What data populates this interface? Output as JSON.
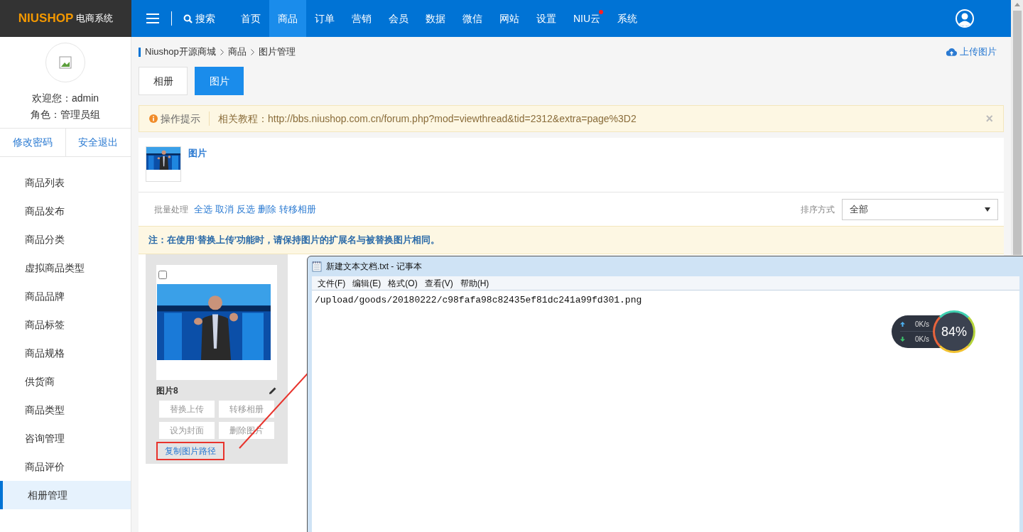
{
  "topbar": {
    "logo_brand": "NIUSHOP",
    "logo_sub": "电商系统",
    "search": "搜索",
    "nav": [
      {
        "label": "首页",
        "selected": false,
        "badge": false
      },
      {
        "label": "商品",
        "selected": true,
        "badge": false
      },
      {
        "label": "订单",
        "selected": false,
        "badge": false
      },
      {
        "label": "营销",
        "selected": false,
        "badge": false
      },
      {
        "label": "会员",
        "selected": false,
        "badge": false
      },
      {
        "label": "数据",
        "selected": false,
        "badge": false
      },
      {
        "label": "微信",
        "selected": false,
        "badge": false
      },
      {
        "label": "网站",
        "selected": false,
        "badge": false
      },
      {
        "label": "设置",
        "selected": false,
        "badge": false
      },
      {
        "label": "NIU云",
        "selected": false,
        "badge": true
      },
      {
        "label": "系统",
        "selected": false,
        "badge": false
      }
    ]
  },
  "sidebar": {
    "welcome": "欢迎您：admin",
    "role": "角色：管理员组",
    "actions": [
      "修改密码",
      "安全退出"
    ],
    "items": [
      {
        "label": "商品列表",
        "selected": false
      },
      {
        "label": "商品发布",
        "selected": false
      },
      {
        "label": "商品分类",
        "selected": false
      },
      {
        "label": "虚拟商品类型",
        "selected": false
      },
      {
        "label": "商品品牌",
        "selected": false
      },
      {
        "label": "商品标签",
        "selected": false
      },
      {
        "label": "商品规格",
        "selected": false
      },
      {
        "label": "供货商",
        "selected": false
      },
      {
        "label": "商品类型",
        "selected": false
      },
      {
        "label": "咨询管理",
        "selected": false
      },
      {
        "label": "商品评价",
        "selected": false
      },
      {
        "label": "相册管理",
        "selected": true
      }
    ]
  },
  "breadcrumb": [
    "Niushop开源商城",
    "商品",
    "图片管理"
  ],
  "upload_link": "上传图片",
  "tabs": [
    {
      "label": "相册",
      "selected": false
    },
    {
      "label": "图片",
      "selected": true
    }
  ],
  "tip": {
    "label": "操作提示",
    "text": "相关教程：http://bbs.niushop.com.cn/forum.php?mod=viewthread&tid=2312&extra=page%3D2",
    "close": "×"
  },
  "album": {
    "name": "图片"
  },
  "batch": {
    "label": "批量处理",
    "actions": [
      "全选",
      "取消",
      "反选",
      "删除",
      "转移相册"
    ],
    "sort_label": "排序方式",
    "sort_value": "全部"
  },
  "note": "注：在使用‘替换上传’功能时，请保持图片的扩展名与被替换图片相同。",
  "photo": {
    "checked": false,
    "name": "图片8",
    "buttons": [
      "替换上传",
      "转移相册",
      "设为封面",
      "删除图片"
    ],
    "copy_link": "复制图片路径",
    "highlighted": true
  },
  "notepad": {
    "title": "新建文本文档.txt - 记事本",
    "menu": [
      "文件(F)",
      "编辑(E)",
      "格式(O)",
      "查看(V)",
      "帮助(H)"
    ],
    "content": "/upload/goods/20180222/c98fafa98c82435ef81dc241a99fd301.png"
  },
  "net_widget": {
    "up": "0K/s",
    "down": "0K/s",
    "reading": "84%"
  }
}
